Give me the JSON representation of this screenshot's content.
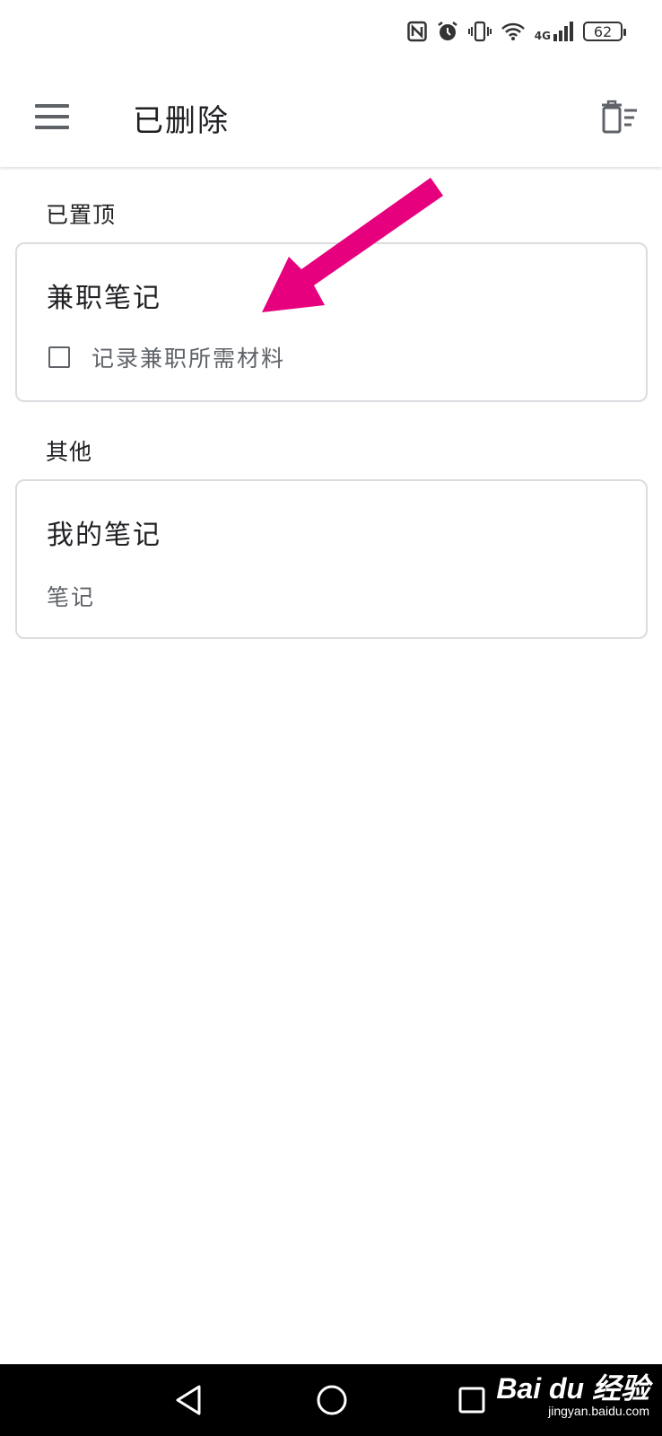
{
  "status_bar": {
    "network_label": "4G",
    "battery_level": "62",
    "icons": [
      "nfc-icon",
      "alarm-icon",
      "vibrate-icon",
      "wifi-icon",
      "cellular-signal-icon",
      "battery-icon"
    ]
  },
  "app_bar": {
    "menu_icon": "hamburger-menu-icon",
    "title": "已删除",
    "action_icon": "delete-sweep-icon"
  },
  "sections": [
    {
      "label": "已置顶",
      "note": {
        "title": "兼职笔记",
        "checklist_item": "记录兼职所需材料",
        "checked": false
      }
    },
    {
      "label": "其他",
      "note": {
        "title": "我的笔记",
        "body": "笔记"
      }
    }
  ],
  "annotation": {
    "arrow_color": "#e6007e"
  },
  "nav_bar": {
    "buttons": [
      "back-icon",
      "home-icon",
      "recents-icon"
    ],
    "watermark": "Bai du 经验",
    "watermark_url": "jingyan.baidu.com"
  },
  "colors": {
    "text_primary": "#202124",
    "text_secondary": "#5f6368",
    "card_border": "#dadce0",
    "nav_bar": "#000000"
  }
}
